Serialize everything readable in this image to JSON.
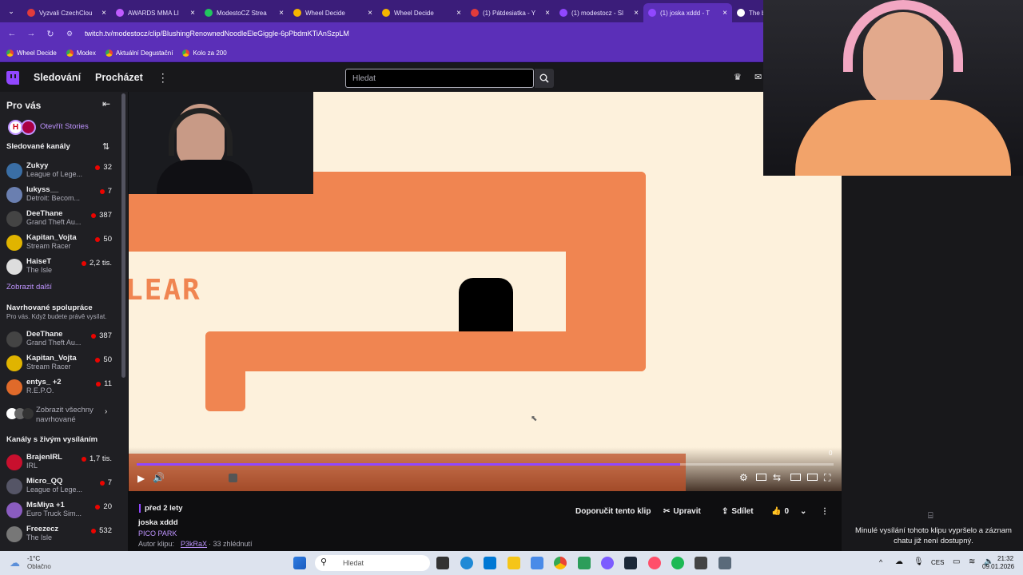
{
  "browser": {
    "tabs": [
      {
        "title": "Vyzvali CzechClou",
        "color": "#e23b3b"
      },
      {
        "title": "AWARDS MMA LI",
        "color": "#c05cff"
      },
      {
        "title": "ModestoCZ Strea",
        "color": "#22c55e"
      },
      {
        "title": "Wheel Decide",
        "color": "#f5b400"
      },
      {
        "title": "Wheel Decide",
        "color": "#f5b400"
      },
      {
        "title": "(1) Pátdesiatka - Y",
        "color": "#e23b3b"
      },
      {
        "title": "(1) modestocz - Sl",
        "color": "#9147ff"
      },
      {
        "title": "(1) joska xddd - T",
        "color": "#9147ff"
      },
      {
        "title": "The b",
        "color": "#ffffff"
      }
    ],
    "url": "twitch.tv/modestocz/clip/BlushingRenownedNoodleEleGiggle-6pPbdmKTiAnSzpLM",
    "bookmarks": [
      "Wheel Decide",
      "Modex",
      "Aktuální Degustační",
      "Kolo za 200"
    ]
  },
  "topnav": {
    "following": "Sledování",
    "browse": "Procházet",
    "search_placeholder": "Hledat"
  },
  "sidebar": {
    "for_you": "Pro vás",
    "stories": "Otevřít Stories",
    "followed_header": "Sledované kanály",
    "followed": [
      {
        "name": "Zukyy",
        "game": "League of Lege...",
        "viewers": "32",
        "color": "#3a6ea5"
      },
      {
        "name": "lukyss__",
        "game": "Detroit: Becom...",
        "viewers": "7",
        "color": "#6a7fb0"
      },
      {
        "name": "DeeThane",
        "game": "Grand Theft Au...",
        "viewers": "387",
        "color": "#444"
      },
      {
        "name": "Kapitan_Vojta",
        "game": "Stream Racer",
        "viewers": "50",
        "color": "#e0b400"
      },
      {
        "name": "HaiseT",
        "game": "The Isle",
        "viewers": "2,2 tis.",
        "color": "#ddd"
      }
    ],
    "show_more": "Zobrazit další",
    "collab_header": "Navrhované spolupráce",
    "collab_sub": "Pro vás. Když budete právě vysílat.",
    "collab": [
      {
        "name": "DeeThane",
        "game": "Grand Theft Au...",
        "viewers": "387",
        "color": "#444"
      },
      {
        "name": "Kapitan_Vojta",
        "game": "Stream Racer",
        "viewers": "50",
        "color": "#e0b400"
      },
      {
        "name": "entys_ +2",
        "game": "R.E.P.O.",
        "viewers": "11",
        "color": "#e06a2a"
      }
    ],
    "show_all": "Zobrazit všechny navrhované",
    "live_header": "Kanály s živým vysíláním",
    "live": [
      {
        "name": "BrajenIRL",
        "game": "IRL",
        "viewers": "1,7 tis.",
        "color": "#c8102e"
      },
      {
        "name": "Micro_QQ",
        "game": "League of Lege...",
        "viewers": "7",
        "color": "#556"
      },
      {
        "name": "MsMiya +1",
        "game": "Euro Truck Sim...",
        "viewers": "20",
        "color": "#8a5cc0"
      },
      {
        "name": "Freezecz",
        "game": "The Isle",
        "viewers": "532",
        "color": "#777"
      }
    ]
  },
  "video": {
    "game_text": "LEAR",
    "progress": 0.78,
    "time_label": "0"
  },
  "clip": {
    "ago": "před 2 lety",
    "title": "joska xddd",
    "game": "PICO PARK",
    "author_prefix": "Autor klipu:",
    "author": "P3kRaX",
    "views": " · 33 zhlédnutí",
    "recommend": "Doporučit tento klip",
    "edit": "Upravit",
    "share": "Sdílet",
    "likes": "0"
  },
  "chat": {
    "message": "Minulé vysílání tohoto klipu vypršelo a záznam chatu již není dostupný."
  },
  "taskbar": {
    "temp": "-1°C",
    "weather": "Oblačno",
    "search": "Hledat",
    "lang": "CES",
    "time": "21:32",
    "date": "09.01.2026"
  }
}
